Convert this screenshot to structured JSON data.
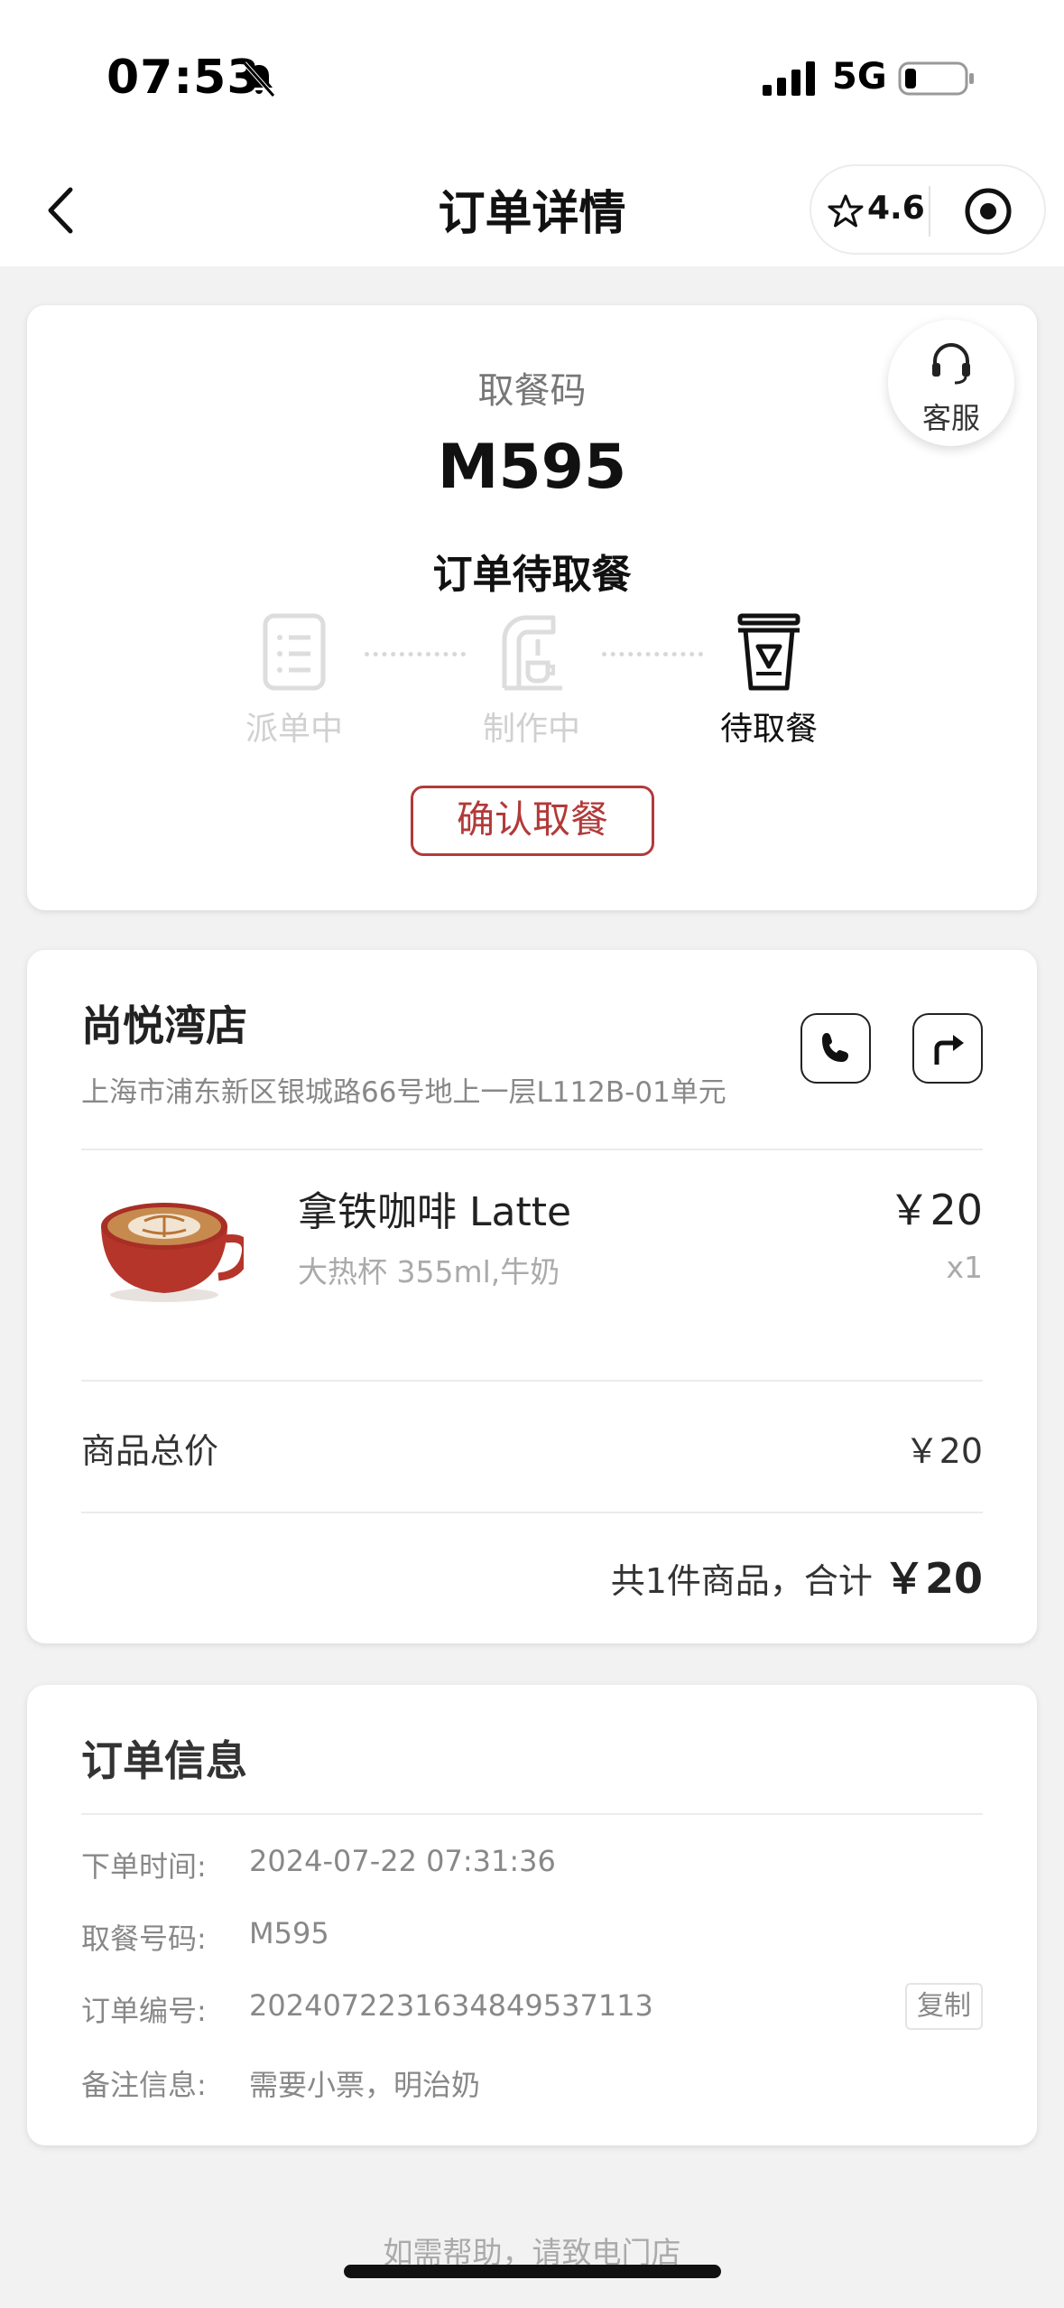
{
  "status_bar": {
    "time": "07:53",
    "network": "5G"
  },
  "nav": {
    "title": "订单详情",
    "rating": "4.6"
  },
  "pickup": {
    "label": "取餐码",
    "code": "M595",
    "status": "订单待取餐",
    "customer_service": "客服",
    "steps": [
      {
        "label": "派单中",
        "active": false
      },
      {
        "label": "制作中",
        "active": false
      },
      {
        "label": "待取餐",
        "active": true
      }
    ],
    "confirm_button": "确认取餐",
    "accent_color": "#b23a3a"
  },
  "store": {
    "name": "尚悦湾店",
    "address": "上海市浦东新区银城路66号地上一层L112B-01单元",
    "item": {
      "name": "拿铁咖啡 Latte",
      "spec": "大热杯 355ml,牛奶",
      "price": "￥20",
      "qty": "x1"
    },
    "total_label": "商品总价",
    "total_value": "￥20",
    "summary_text": "共1件商品，合计",
    "summary_amount": "￥20"
  },
  "order_info": {
    "title": "订单信息",
    "rows": [
      {
        "key": "下单时间:",
        "value": "2024-07-22 07:31:36"
      },
      {
        "key": "取餐号码:",
        "value": "M595"
      },
      {
        "key": "订单编号:",
        "value": "2024072231634849537113"
      },
      {
        "key": "备注信息:",
        "value": "需要小票，明治奶"
      }
    ],
    "copy_button": "复制"
  },
  "footer": {
    "help_prefix": "如需帮助，请",
    "help_link": "致电门店"
  }
}
